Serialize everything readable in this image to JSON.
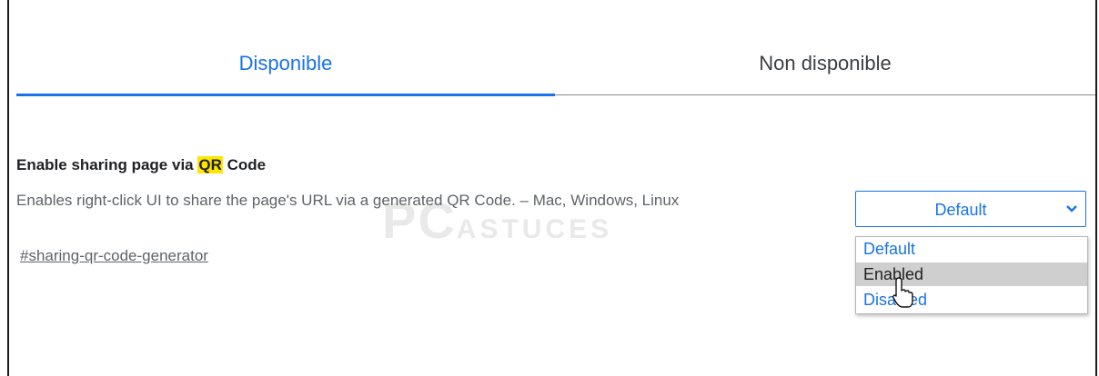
{
  "tabs": [
    {
      "label": "Disponible",
      "active": true
    },
    {
      "label": "Non disponible",
      "active": false
    }
  ],
  "experiment": {
    "title_before": "Enable sharing page via ",
    "title_highlight": "QR",
    "title_after": " Code",
    "description": "Enables right-click UI to share the page's URL via a generated QR Code. – Mac, Windows, Linux",
    "link": "#sharing-qr-code-generator"
  },
  "select": {
    "value": "Default",
    "options": [
      "Default",
      "Enabled",
      "Disabled"
    ],
    "hovered_option": "Enabled"
  },
  "watermark": {
    "main": "PC",
    "sub": "ASTUCES"
  },
  "colors": {
    "accent": "#1a73e8",
    "highlight": "#ffe600",
    "text": "#202124",
    "secondary": "#5f6368"
  },
  "icons": {
    "chevron": "chevron-down-icon",
    "cursor": "mouse-pointer-icon"
  }
}
